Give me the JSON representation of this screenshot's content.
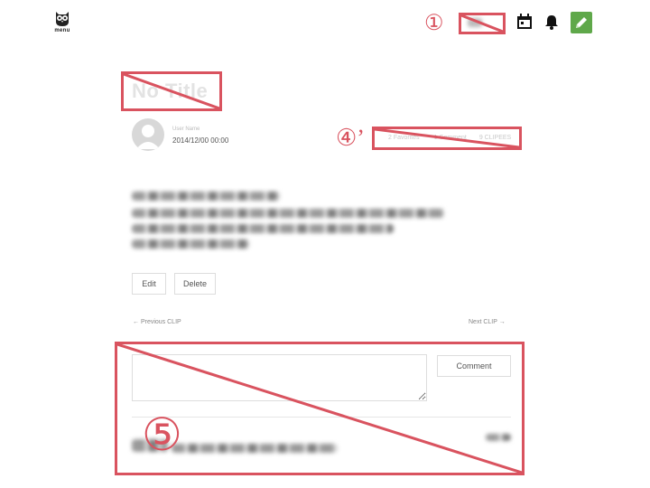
{
  "header": {
    "menu_label": "menu"
  },
  "annotations": {
    "label_1": "①",
    "label_4": "④’",
    "label_5": "⑤"
  },
  "post": {
    "title": "No Title",
    "username": "User Name",
    "date": "2014/12/00 00:00",
    "favorites": "2 Favorites",
    "stat_middle": "1 Comment",
    "clips": "9 CLIPEES"
  },
  "actions": {
    "edit_label": "Edit",
    "delete_label": "Delete"
  },
  "navigation": {
    "previous_label": "← Previous CLIP",
    "next_label": "Next CLIP →"
  },
  "comments": {
    "submit_label": "Comment"
  },
  "colors": {
    "annotation": "#d9535f",
    "edit_button": "#5fa84a"
  },
  "icons": [
    "owl-menu-icon",
    "calendar-icon",
    "bell-icon",
    "pencil-icon",
    "user-avatar-icon"
  ]
}
